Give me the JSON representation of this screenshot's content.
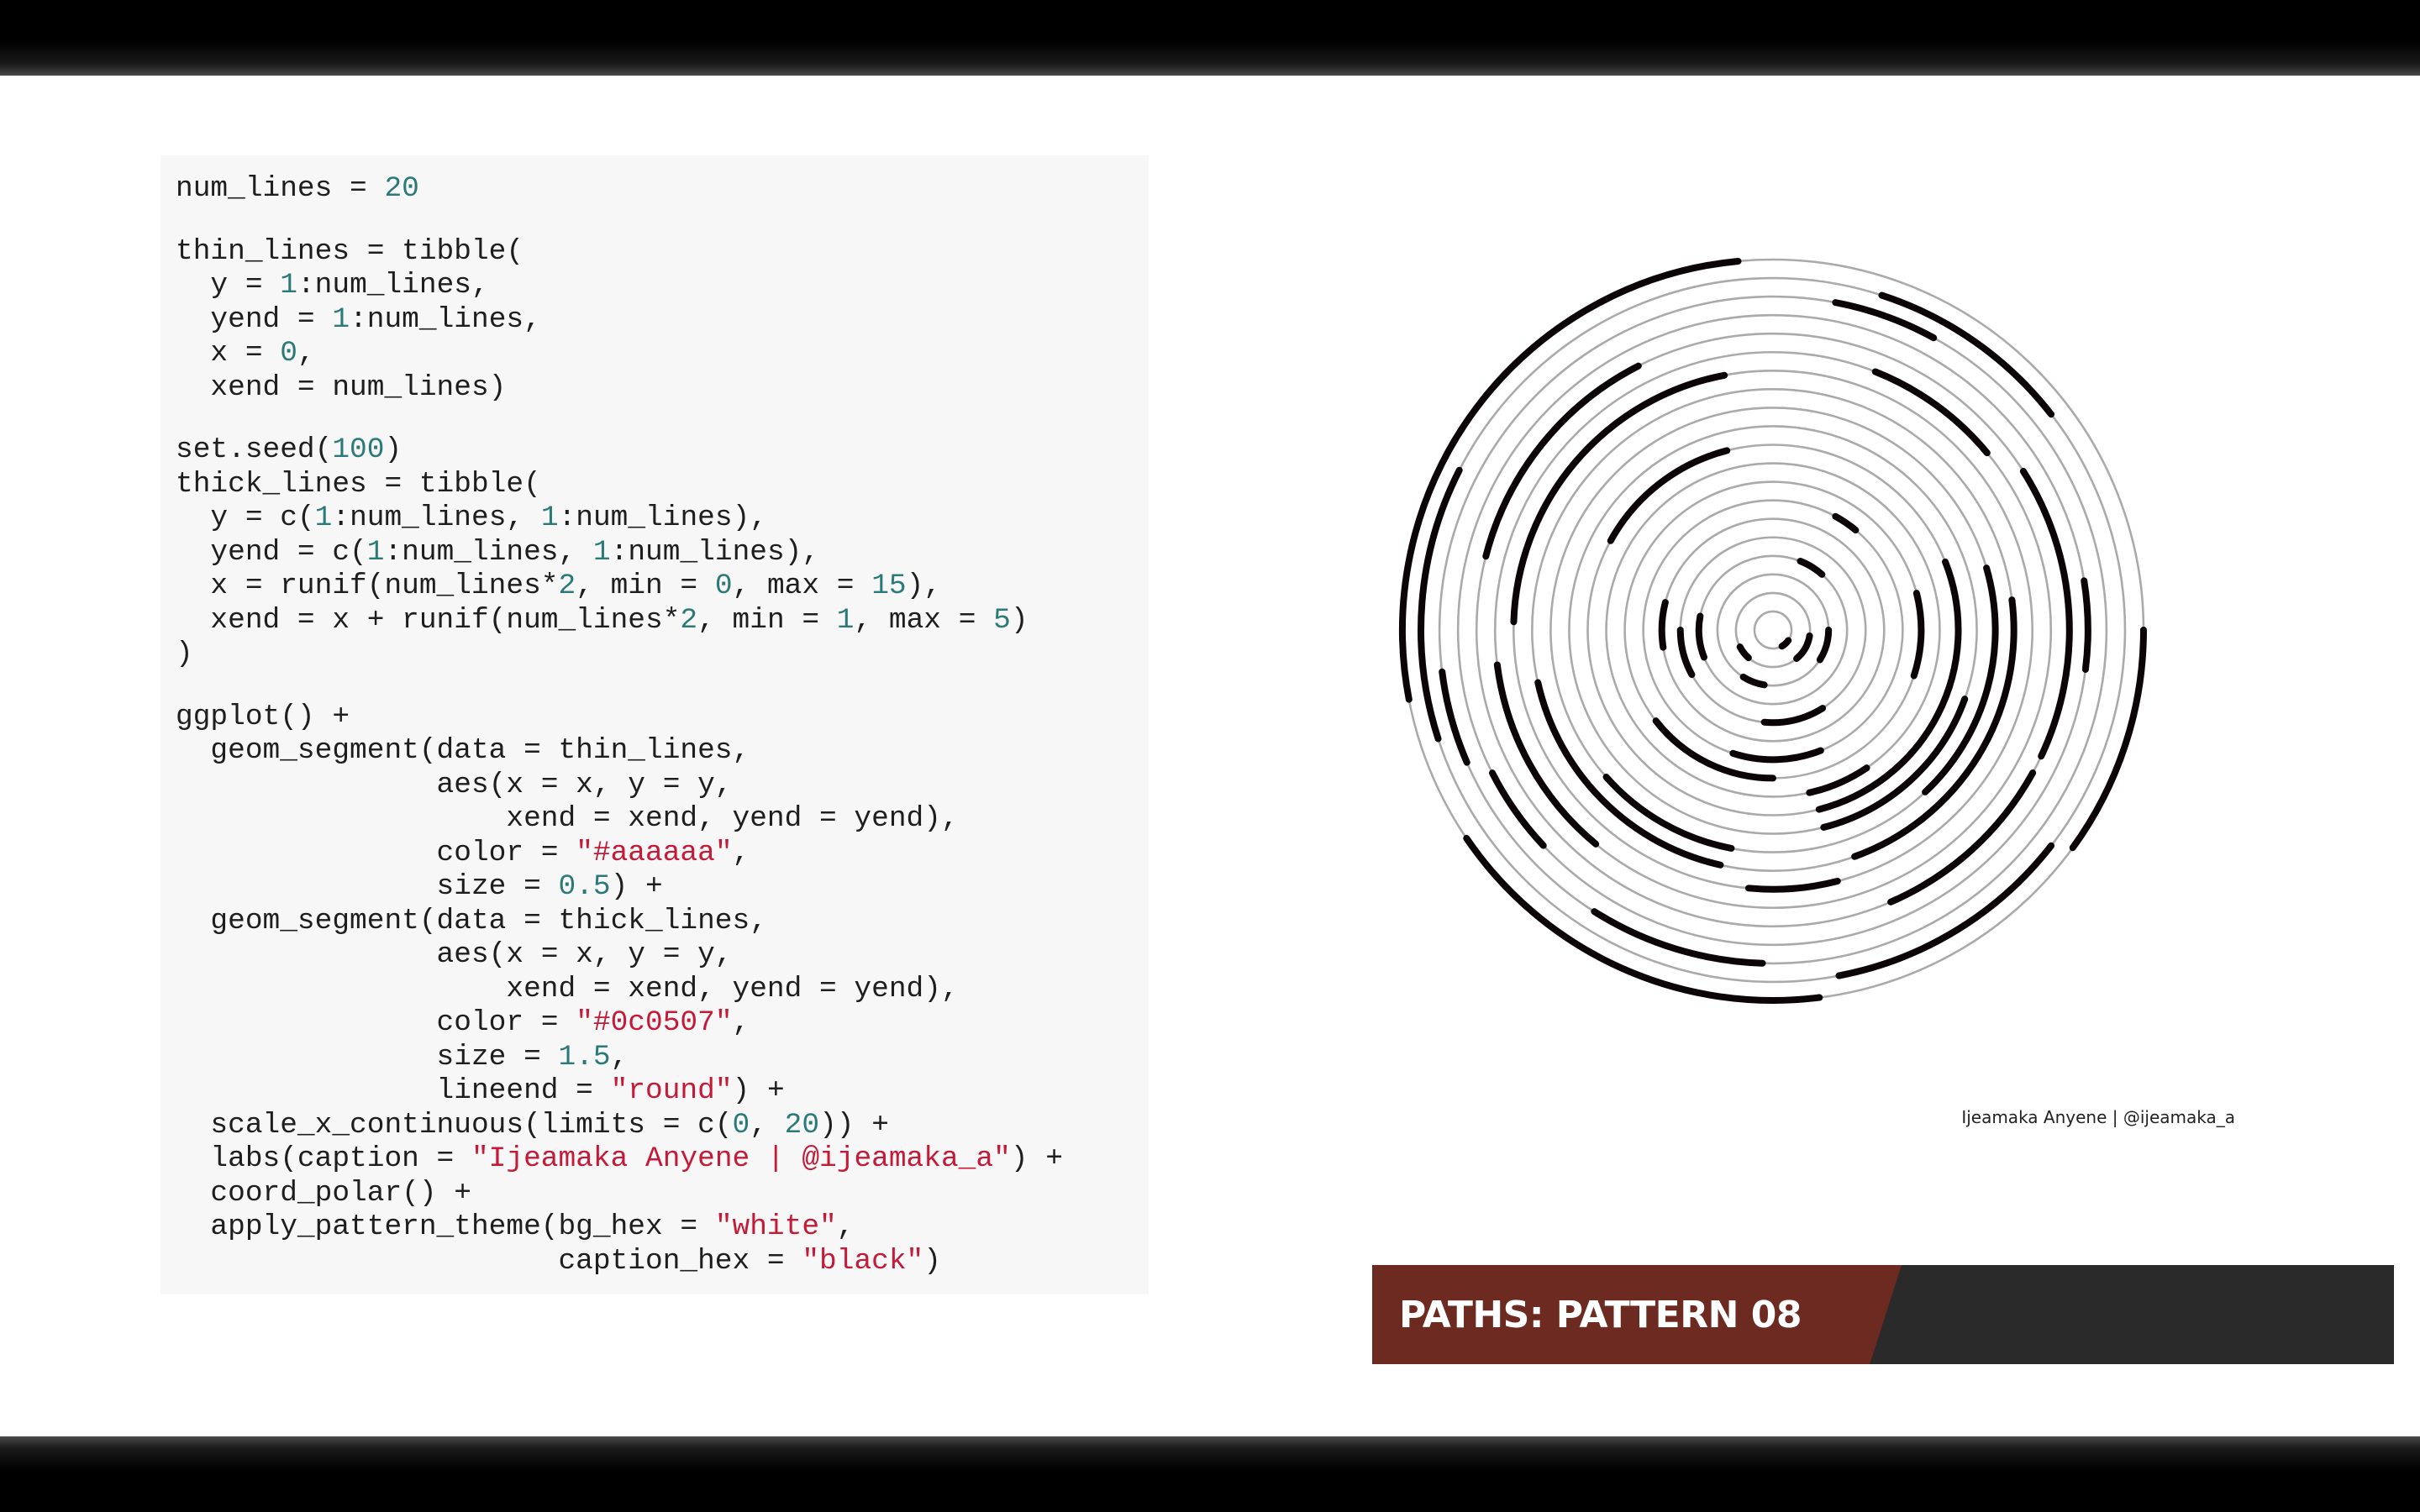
{
  "slide": {
    "title": "PATHS: PATTERN 08",
    "caption": "Ijeamaka Anyene | @ijeamaka_a",
    "colors": {
      "banner_accent": "#6d2a20",
      "banner_dark": "#2a2a2a",
      "code_bg": "#f7f7f7",
      "code_number": "#2b7a78",
      "code_string": "#c41a38",
      "thin_line": "#aaaaaa",
      "thick_line": "#0c0507"
    }
  },
  "code": {
    "lines": [
      [
        [
          "num_lines = ",
          "t"
        ],
        [
          "20",
          "n"
        ]
      ],
      [],
      [
        [
          "thin_lines = tibble(",
          "t"
        ]
      ],
      [
        [
          "  y = ",
          "t"
        ],
        [
          "1",
          "n"
        ],
        [
          ":num_lines,",
          "t"
        ]
      ],
      [
        [
          "  yend = ",
          "t"
        ],
        [
          "1",
          "n"
        ],
        [
          ":num_lines,",
          "t"
        ]
      ],
      [
        [
          "  x = ",
          "t"
        ],
        [
          "0",
          "n"
        ],
        [
          ",",
          "t"
        ]
      ],
      [
        [
          "  xend = num_lines)",
          "t"
        ]
      ],
      [],
      [
        [
          "set.seed(",
          "t"
        ],
        [
          "100",
          "n"
        ],
        [
          ")",
          "t"
        ]
      ],
      [
        [
          "thick_lines = tibble(",
          "t"
        ]
      ],
      [
        [
          "  y = c(",
          "t"
        ],
        [
          "1",
          "n"
        ],
        [
          ":num_lines, ",
          "t"
        ],
        [
          "1",
          "n"
        ],
        [
          ":num_lines),",
          "t"
        ]
      ],
      [
        [
          "  yend = c(",
          "t"
        ],
        [
          "1",
          "n"
        ],
        [
          ":num_lines, ",
          "t"
        ],
        [
          "1",
          "n"
        ],
        [
          ":num_lines),",
          "t"
        ]
      ],
      [
        [
          "  x = runif(num_lines*",
          "t"
        ],
        [
          "2",
          "n"
        ],
        [
          ", min = ",
          "t"
        ],
        [
          "0",
          "n"
        ],
        [
          ", max = ",
          "t"
        ],
        [
          "15",
          "n"
        ],
        [
          "),",
          "t"
        ]
      ],
      [
        [
          "  xend = x + runif(num_lines*",
          "t"
        ],
        [
          "2",
          "n"
        ],
        [
          ", min = ",
          "t"
        ],
        [
          "1",
          "n"
        ],
        [
          ", max = ",
          "t"
        ],
        [
          "5",
          "n"
        ],
        [
          ")",
          "t"
        ]
      ],
      [
        [
          ")",
          "t"
        ]
      ],
      [],
      [
        [
          "ggplot() +",
          "t"
        ]
      ],
      [
        [
          "  geom_segment(data = thin_lines,",
          "t"
        ]
      ],
      [
        [
          "               aes(x = x, y = y,",
          "t"
        ]
      ],
      [
        [
          "                   xend = xend, yend = yend),",
          "t"
        ]
      ],
      [
        [
          "               color = ",
          "t"
        ],
        [
          "\"#aaaaaa\"",
          "s"
        ],
        [
          ",",
          "t"
        ]
      ],
      [
        [
          "               size = ",
          "t"
        ],
        [
          "0.5",
          "n"
        ],
        [
          ") +",
          "t"
        ]
      ],
      [
        [
          "  geom_segment(data = thick_lines,",
          "t"
        ]
      ],
      [
        [
          "               aes(x = x, y = y,",
          "t"
        ]
      ],
      [
        [
          "                   xend = xend, yend = yend),",
          "t"
        ]
      ],
      [
        [
          "               color = ",
          "t"
        ],
        [
          "\"#0c0507\"",
          "s"
        ],
        [
          ",",
          "t"
        ]
      ],
      [
        [
          "               size = ",
          "t"
        ],
        [
          "1.5",
          "n"
        ],
        [
          ",",
          "t"
        ]
      ],
      [
        [
          "               lineend = ",
          "t"
        ],
        [
          "\"round\"",
          "s"
        ],
        [
          ") +",
          "t"
        ]
      ],
      [
        [
          "  scale_x_continuous(limits = c(",
          "t"
        ],
        [
          "0",
          "n"
        ],
        [
          ", ",
          "t"
        ],
        [
          "20",
          "n"
        ],
        [
          ")) +",
          "t"
        ]
      ],
      [
        [
          "  labs(caption = ",
          "t"
        ],
        [
          "\"Ijeamaka Anyene | @ijeamaka_a\"",
          "s"
        ],
        [
          ") +",
          "t"
        ]
      ],
      [
        [
          "  coord_polar() +",
          "t"
        ]
      ],
      [
        [
          "  apply_pattern_theme(bg_hex = ",
          "t"
        ],
        [
          "\"white\"",
          "s"
        ],
        [
          ",",
          "t"
        ]
      ],
      [
        [
          "                      caption_hex = ",
          "t"
        ],
        [
          "\"black\"",
          "s"
        ],
        [
          ")",
          "t"
        ]
      ]
    ]
  },
  "chart_data": {
    "type": "polar-segments",
    "theta_limits": [
      0,
      20
    ],
    "radius_range": [
      1,
      20
    ],
    "thin_rings": [
      1,
      2,
      3,
      4,
      5,
      6,
      7,
      8,
      9,
      10,
      11,
      12,
      13,
      14,
      15,
      16,
      17,
      18,
      19,
      20
    ],
    "thick_segments": [
      {
        "r": 1,
        "x": 6.9,
        "xend": 8.4
      },
      {
        "r": 2,
        "x": 5.5,
        "xend": 7.8
      },
      {
        "r": 3,
        "x": 5.0,
        "xend": 6.8
      },
      {
        "r": 4,
        "x": 1.2,
        "xend": 2.3
      },
      {
        "r": 5,
        "x": 8.2,
        "xend": 10.3
      },
      {
        "r": 6,
        "x": 14.5,
        "xend": 15.8
      },
      {
        "r": 7,
        "x": 8.8,
        "xend": 11.0
      },
      {
        "r": 8,
        "x": 10.0,
        "xend": 12.9
      },
      {
        "r": 9,
        "x": 8.1,
        "xend": 9.3
      },
      {
        "r": 10,
        "x": 3.8,
        "xend": 9.2
      },
      {
        "r": 11,
        "x": 6.1,
        "xend": 9.2
      },
      {
        "r": 12,
        "x": 4.1,
        "xend": 7.6
      },
      {
        "r": 13,
        "x": 4.6,
        "xend": 8.9
      },
      {
        "r": 14,
        "x": 15.1,
        "xend": 19.4
      },
      {
        "r": 15,
        "x": 12.2,
        "xend": 14.6
      },
      {
        "r": 16,
        "x": 6.6,
        "xend": 8.7
      },
      {
        "r": 17,
        "x": 4.5,
        "xend": 5.4
      },
      {
        "r": 18,
        "x": 13.7,
        "xend": 14.6
      },
      {
        "r": 19,
        "x": 1.0,
        "xend": 2.9
      },
      {
        "r": 20,
        "x": 9.6,
        "xend": 13.1
      },
      {
        "r": 2,
        "x": 12.3,
        "xend": 13.5
      },
      {
        "r": 3,
        "x": 10.5,
        "xend": 11.8
      },
      {
        "r": 4,
        "x": 13.8,
        "xend": 15.6
      },
      {
        "r": 5,
        "x": 13.4,
        "xend": 15.0
      },
      {
        "r": 7,
        "x": 1.6,
        "xend": 2.2
      },
      {
        "r": 8,
        "x": 4.2,
        "xend": 6.0
      },
      {
        "r": 10,
        "x": 16.6,
        "xend": 19.2
      },
      {
        "r": 12,
        "x": 10.6,
        "xend": 12.7
      },
      {
        "r": 13,
        "x": 10.7,
        "xend": 14.3
      },
      {
        "r": 14,
        "x": 9.2,
        "xend": 10.3
      },
      {
        "r": 15,
        "x": 1.2,
        "xend": 2.8
      },
      {
        "r": 16,
        "x": 3.2,
        "xend": 6.4
      },
      {
        "r": 16,
        "x": 15.8,
        "xend": 18.5
      },
      {
        "r": 17,
        "x": 12.6,
        "xend": 13.5
      },
      {
        "r": 18,
        "x": 0.6,
        "xend": 1.6
      },
      {
        "r": 18,
        "x": 10.1,
        "xend": 11.8
      },
      {
        "r": 19,
        "x": 7.1,
        "xend": 9.4
      },
      {
        "r": 19,
        "x": 14.0,
        "xend": 16.5
      },
      {
        "r": 20,
        "x": 5.0,
        "xend": 7.0
      },
      {
        "r": 20,
        "x": 14.4,
        "xend": 19.7
      }
    ]
  }
}
